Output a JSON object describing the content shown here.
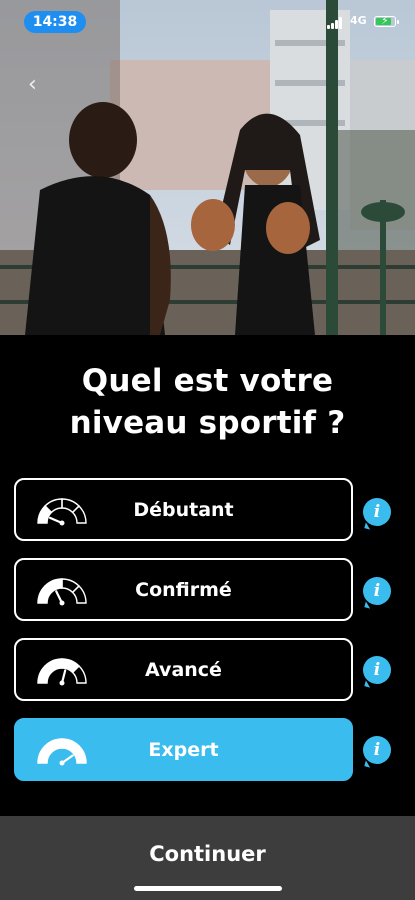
{
  "status_bar": {
    "time": "14:38",
    "network": "4G"
  },
  "question": {
    "line1": "Quel est votre",
    "line2": "niveau sportif ?"
  },
  "levels": [
    {
      "label": "Débutant",
      "gauge_level": 0.25,
      "selected": false
    },
    {
      "label": "Confirmé",
      "gauge_level": 0.5,
      "selected": false
    },
    {
      "label": "Avancé",
      "gauge_level": 0.75,
      "selected": false
    },
    {
      "label": "Expert",
      "gauge_level": 1.0,
      "selected": true
    }
  ],
  "info_glyph": "i",
  "footer": {
    "continue_label": "Continuer"
  },
  "colors": {
    "accent": "#3bbcee",
    "footer_bg": "#3d3d3d",
    "status_time_bg": "#1f8ef1"
  }
}
